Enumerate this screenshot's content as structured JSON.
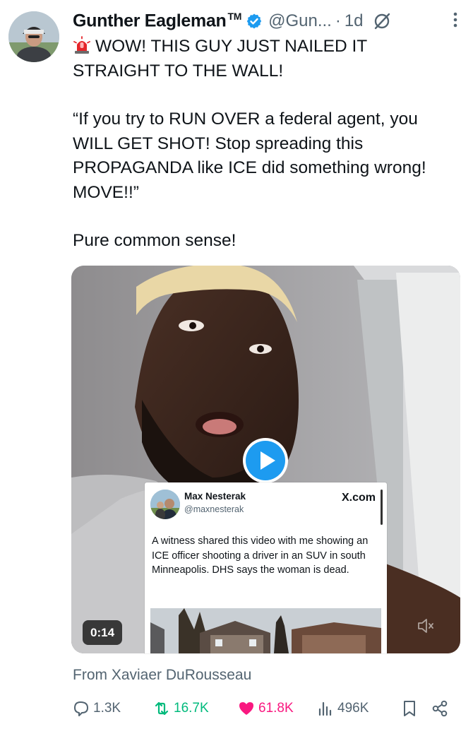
{
  "author": {
    "name": "Gunther Eagleman",
    "tm": "TM",
    "handle": "@Gun...",
    "separator": "·",
    "time": "1d"
  },
  "tweet": {
    "line1": "WOW! THIS GUY JUST NAILED IT STRAIGHT TO THE WALL!",
    "quote": "“If you try to RUN OVER a federal agent, you WILL GET SHOT! Stop spreading this PROPAGANDA like ICE did something wrong! MOVE!!”",
    "closing": "Pure common sense!"
  },
  "media": {
    "duration": "0:14",
    "embedded_post": {
      "name": "Max Nesterak",
      "handle": "@maxnesterak",
      "site": "X.com",
      "text": "A witness shared this video with me showing an ICE officer shooting a driver in an SUV in south Minneapolis. DHS says the woman is dead."
    }
  },
  "attribution": "From Xaviaer DuRousseau",
  "actions": {
    "replies": "1.3K",
    "reposts": "16.7K",
    "likes": "61.8K",
    "views": "496K"
  },
  "colors": {
    "verified": "#1d9bf0",
    "repost": "#00ba7c",
    "like": "#f91880",
    "play": "#1d9bf0",
    "muted_text": "#536471"
  },
  "icons": [
    "verified-badge-icon",
    "grok-icon",
    "more-icon",
    "siren-icon",
    "play-icon",
    "mute-icon",
    "reply-icon",
    "repost-icon",
    "like-icon",
    "views-icon",
    "bookmark-icon",
    "share-icon"
  ]
}
